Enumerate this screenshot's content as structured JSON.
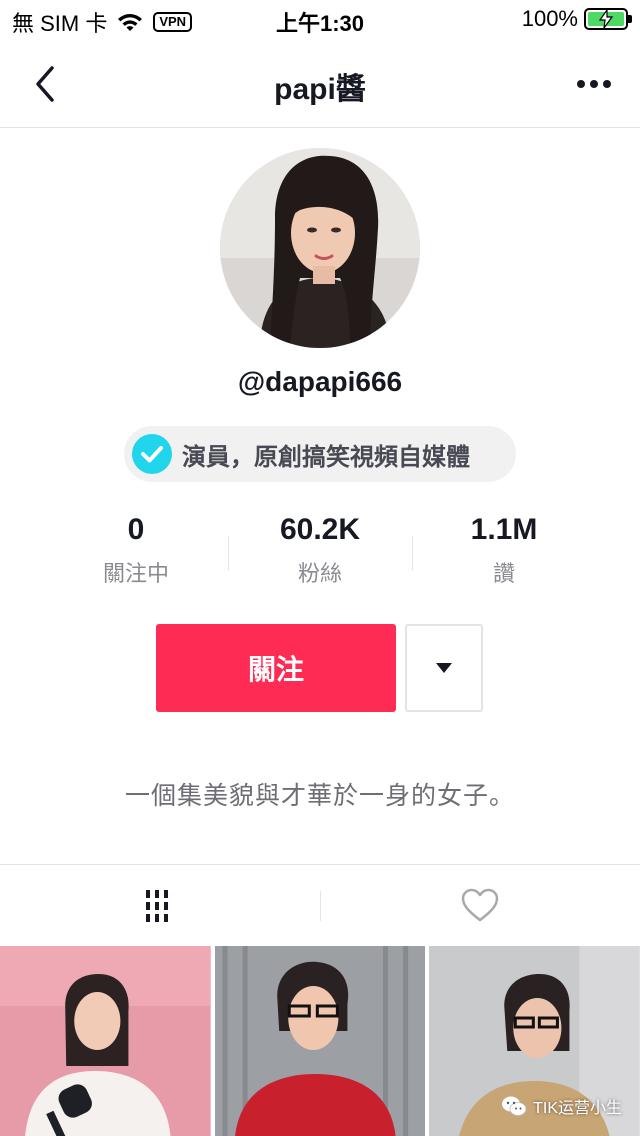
{
  "status_bar": {
    "carrier": "無 SIM 卡",
    "vpn": "VPN",
    "time": "上午1:30",
    "battery_percent": "100%",
    "battery_level": 1.0
  },
  "header": {
    "title": "papi醬",
    "back_icon": "chevron-left-icon",
    "more_icon": "more-horizontal-icon"
  },
  "profile": {
    "username": "@dapapi666",
    "verification": "演員，原創搞笑視頻自媒體",
    "stats": [
      {
        "value": "0",
        "label": "關注中"
      },
      {
        "value": "60.2K",
        "label": "粉絲"
      },
      {
        "value": "1.1M",
        "label": "讚"
      }
    ],
    "follow_label": "關注",
    "bio": "一個集美貌與才華於一身的女子。"
  },
  "tabs": [
    {
      "name": "videos",
      "icon": "grid-columns-icon",
      "active": true
    },
    {
      "name": "liked",
      "icon": "heart-outline-icon",
      "active": false
    }
  ],
  "watermark": "TIK运营小生",
  "colors": {
    "accent": "#fe2c55",
    "verify": "#20d5ec",
    "text_primary": "#161823",
    "text_secondary": "#8a8b91"
  }
}
